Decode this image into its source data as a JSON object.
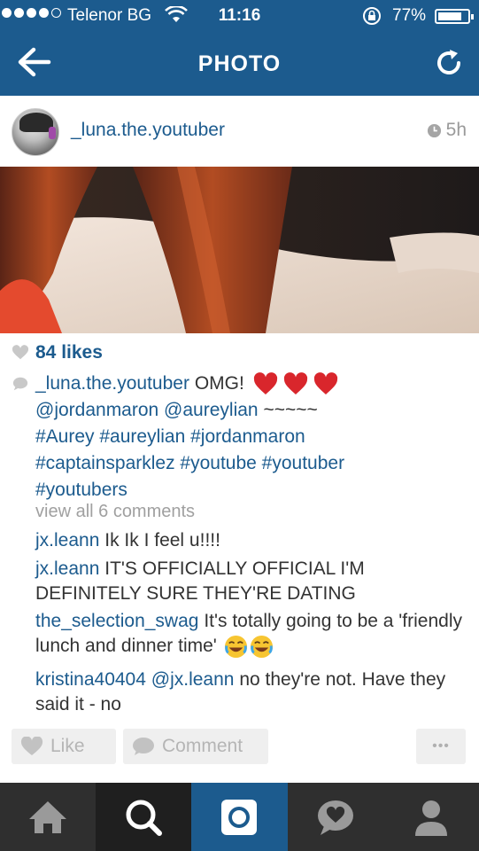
{
  "status_bar": {
    "carrier": "Telenor BG",
    "time": "11:16",
    "battery": "77%",
    "battery_level": 0.77,
    "signal_bars": 4
  },
  "nav": {
    "title": "PHOTO",
    "back_icon": "arrow-left-icon",
    "refresh_icon": "refresh-icon"
  },
  "post": {
    "username": "_luna.the.youtuber",
    "time_ago": "5h",
    "likes": "84 likes",
    "caption": {
      "username": "_luna.the.youtuber",
      "text": "OMG!",
      "mentions": "@jordanmaron @aureylian",
      "tilde": "~~~~~",
      "hashtags_line1": "#Aurey #aureylian #jordanmaron",
      "hashtags_line2": "#captainsparklez #youtube #youtuber",
      "hashtags_line3": "#youtubers"
    },
    "view_all": "view all 6 comments",
    "comments": [
      {
        "user": "jx.leann",
        "text": "Ik Ik I feel u!!!!"
      },
      {
        "user": "jx.leann",
        "text": "IT'S OFFICIALLY OFFICIAL I'M DEFINITELY SURE THEY'RE DATING"
      },
      {
        "user": "the_selection_swag",
        "text": "It's totally going to be a 'friendly lunch and dinner time'"
      },
      {
        "user": "kristina40404",
        "mention": "@jx.leann",
        "text": "no they're not. Have they said it - no"
      }
    ]
  },
  "actions": {
    "like": "Like",
    "comment": "Comment",
    "more": "•••"
  },
  "tabs": [
    "home-icon",
    "search-icon",
    "camera-icon",
    "activity-icon",
    "profile-icon"
  ],
  "colors": {
    "brand_blue": "#1c5b8e",
    "tab_bar": "#2f2f2f",
    "heart_red": "#d9262c"
  }
}
